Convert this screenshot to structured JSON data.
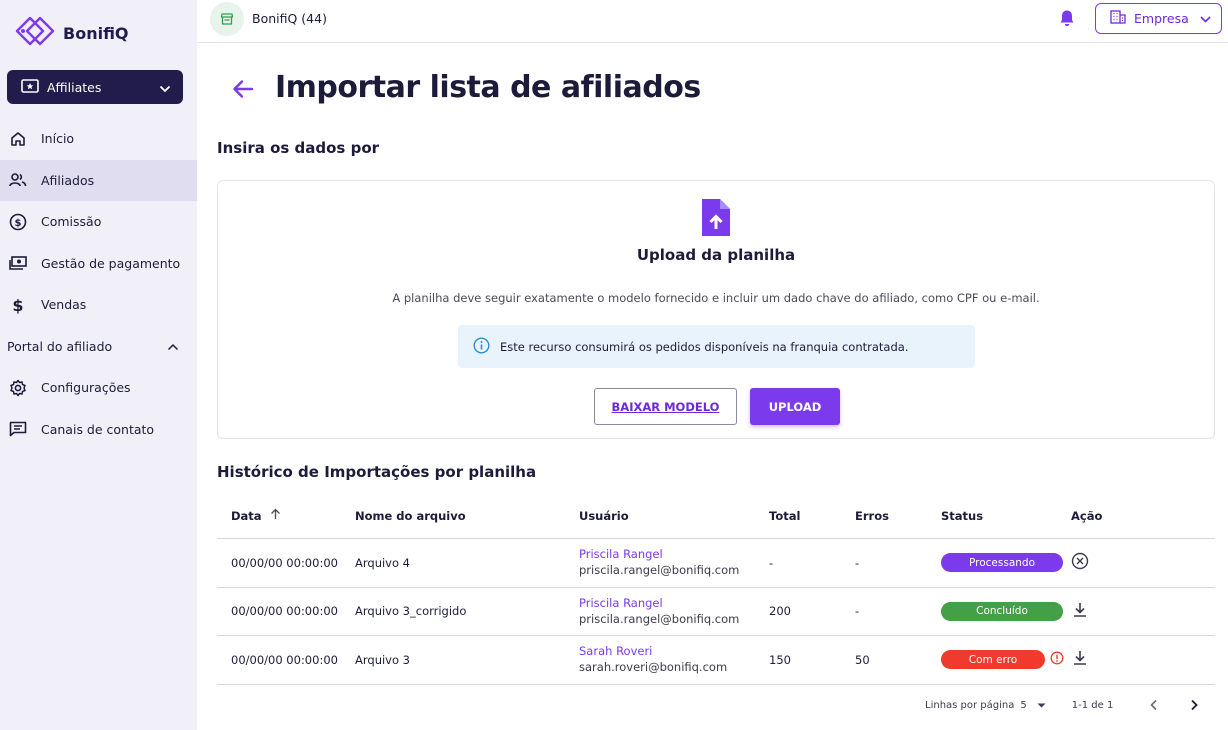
{
  "app": {
    "logo_text": "BonifiQ"
  },
  "sidebar": {
    "module_label": "Affiliates",
    "items": [
      {
        "label": "Início",
        "icon": "home-icon"
      },
      {
        "label": "Afiliados",
        "icon": "users-icon"
      },
      {
        "label": "Comissão",
        "icon": "dollar-circle-icon"
      },
      {
        "label": "Gestão de pagamento",
        "icon": "payment-icon"
      },
      {
        "label": "Vendas",
        "icon": "dollar-icon"
      }
    ],
    "section_label": "Portal do afiliado",
    "section_items": [
      {
        "label": "Configurações",
        "icon": "gear-icon"
      },
      {
        "label": "Canais de contato",
        "icon": "chat-icon"
      }
    ]
  },
  "topbar": {
    "store_name": "BonifiQ (44)",
    "company_label": "Empresa"
  },
  "page": {
    "title": "Importar lista de afiliados",
    "input_section_title": "Insira os dados por",
    "history_section_title": "Histórico de Importações por planilha"
  },
  "upload": {
    "title": "Upload da planilha",
    "description": "A planilha deve seguir exatamente o modelo fornecido e incluir um dado chave do afiliado, como CPF ou e-mail.",
    "info_text": "Este recurso consumirá os pedidos disponíveis na franquia contratada.",
    "download_button": "BAIXAR MODELO",
    "upload_button": "UPLOAD"
  },
  "table": {
    "headers": {
      "date": "Data",
      "file": "Nome do arquivo",
      "user": "Usuário",
      "total": "Total",
      "errors": "Erros",
      "status": "Status",
      "action": "Ação"
    },
    "rows": [
      {
        "date": "00/00/00 00:00:00",
        "file": "Arquivo 4",
        "user_name": "Priscila Rangel",
        "user_email": "priscila.rangel@bonifiq.com",
        "total": "-",
        "errors": "-",
        "status": "Processando",
        "action_icon": "cancel-icon"
      },
      {
        "date": "00/00/00 00:00:00",
        "file": "Arquivo 3_corrigido",
        "user_name": "Priscila Rangel",
        "user_email": "priscila.rangel@bonifiq.com",
        "total": "200",
        "errors": "-",
        "status": "Concluído",
        "action_icon": "download-icon"
      },
      {
        "date": "00/00/00 00:00:00",
        "file": "Arquivo 3",
        "user_name": "Sarah Roveri",
        "user_email": "sarah.roveri@bonifiq.com",
        "total": "150",
        "errors": "50",
        "status": "Com erro",
        "action_icon": "download-icon"
      }
    ]
  },
  "pagination": {
    "rows_per_page_label": "Linhas por página",
    "rows_per_page": "5",
    "range": "1-1 de 1"
  },
  "colors": {
    "primary": "#7c3aed",
    "sidebar_dark": "#221c4d",
    "success": "#43a047",
    "error": "#f03a2e",
    "info_bg": "#e9f3fb"
  }
}
